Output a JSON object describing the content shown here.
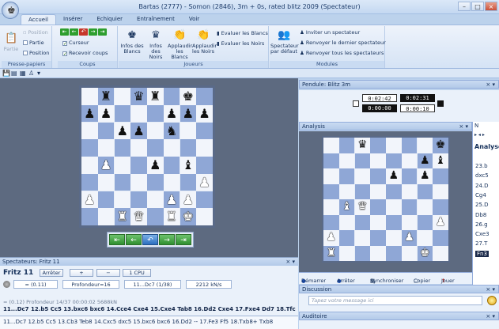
{
  "window": {
    "title": "Bartas (2777) - Somon (2846), 3m + 0s, rated blitz 2009 (Spectateur)"
  },
  "tabs": [
    "Accueil",
    "Insérer",
    "Echiquier",
    "Entraînement",
    "Voir"
  ],
  "ribbon": {
    "presse": {
      "partie": "Partie",
      "position1": "Position",
      "partie2": "Partie",
      "position2": "Position",
      "title": "Presse-papiers"
    },
    "coups": {
      "curseur": "Curseur",
      "recevoir": "Recevoir coups",
      "title": "Coups"
    },
    "joueurs": {
      "infos_blancs": "Infos des Blancs",
      "infos_noirs": "Infos des Noirs",
      "applaudir_blancs": "Applaudir les Blancs",
      "applaudir_noirs": "Applaudir les Noirs",
      "evaluer_blancs": "Evaluer les Blancs",
      "evaluer_noirs": "Evaluer les Noirs",
      "title": "Joueurs"
    },
    "modules": {
      "spectateur": "Spectateur par défaut",
      "inviter": "Inviter un spectateur",
      "renvoyer_dernier": "Renvoyer le dernier spectateur",
      "renvoyer_tous": "Renvoyer tous les spectateurs",
      "title": "Modules"
    }
  },
  "board": {
    "rows": [
      [
        "",
        "bR",
        "",
        "bQ",
        "bR",
        "",
        "bK",
        ""
      ],
      [
        "bP",
        "bP",
        "",
        "",
        "",
        "bP",
        "bP",
        "bP"
      ],
      [
        "",
        "",
        "bP",
        "bP",
        "",
        "bN",
        "",
        ""
      ],
      [
        "",
        "",
        "",
        "",
        "",
        "",
        "",
        ""
      ],
      [
        "",
        "wP",
        "",
        "",
        "bP",
        "",
        "bB",
        ""
      ],
      [
        "",
        "",
        "",
        "",
        "",
        "",
        "",
        "wP"
      ],
      [
        "wP",
        "",
        "",
        "",
        "",
        "wP",
        "wP",
        ""
      ],
      [
        "",
        "",
        "wR",
        "wQ",
        "",
        "wR",
        "wK",
        ""
      ]
    ]
  },
  "engine_panel": {
    "title": "Spectateurs: Fritz 11",
    "name": "Fritz 11",
    "stop": "Arrêter",
    "plus": "+",
    "minus": "−",
    "cpu": "1 CPU",
    "eval": "= (0.11)",
    "depth": "Profondeur=16",
    "move": "11...Dc7 (1/38)",
    "speed": "2212 kN/s",
    "line_dim": "= (0.12)   Profondeur 14/37   00:00:02   5688kN",
    "line_bold": "11...Dc7 12.b5 Cc5 13.bxc6 bxc6 14.Cce4 Cxe4 15.Cxe4 Tab8 16.Dd2 Cxe4 17.Fxe4 Dd7 18.Tfc",
    "line_last": "11...Dc7 12.b5 Cc5 13.Cb3 Teb8 14.Cxc5 dxc5 15.bxc6 bxc6 16.Dd2 -- 17.Fe3 Ff5 18.Txb8+ Txb8"
  },
  "clock": {
    "title": "Pendule: Blitz 3m",
    "white_time": "0:02:42",
    "black_time": "0:02:31",
    "white_inc": "0:00:00",
    "black_inc": "0:00:10"
  },
  "analysis": {
    "title": "Analysis",
    "rows": [
      [
        "",
        "",
        "bQ",
        "",
        "",
        "",
        "",
        "bK"
      ],
      [
        "",
        "",
        "",
        "",
        "",
        "",
        "bP",
        "bB"
      ],
      [
        "",
        "",
        "",
        "",
        "bP",
        "",
        "bP",
        ""
      ],
      [
        "",
        "",
        "",
        "",
        "",
        "",
        "",
        ""
      ],
      [
        "",
        "wB",
        "wQ",
        "",
        "",
        "",
        "",
        ""
      ],
      [
        "",
        "",
        "",
        "",
        "",
        "",
        "",
        "wP"
      ],
      [
        "wP",
        "",
        "",
        "",
        "",
        "wP",
        "",
        ""
      ],
      [
        "wR",
        "",
        "",
        "",
        "",
        "",
        "wK",
        ""
      ]
    ],
    "start": "Démarrer",
    "stop": "Arrêter",
    "sync": "Synchroniser",
    "copy": "Copier",
    "play": "Jouer"
  },
  "notation": {
    "header": "N",
    "label": "Analyse",
    "moves": [
      "23.b",
      "dxc5",
      "24.D",
      "Cg4",
      "25.D",
      "Db8",
      "26.g",
      "Cxe3",
      "27.T",
      "Fn3"
    ]
  },
  "discussion": {
    "title": "Discussion",
    "placeholder": "Tapez votre message ici"
  },
  "audience": {
    "title": "Auditoire"
  }
}
